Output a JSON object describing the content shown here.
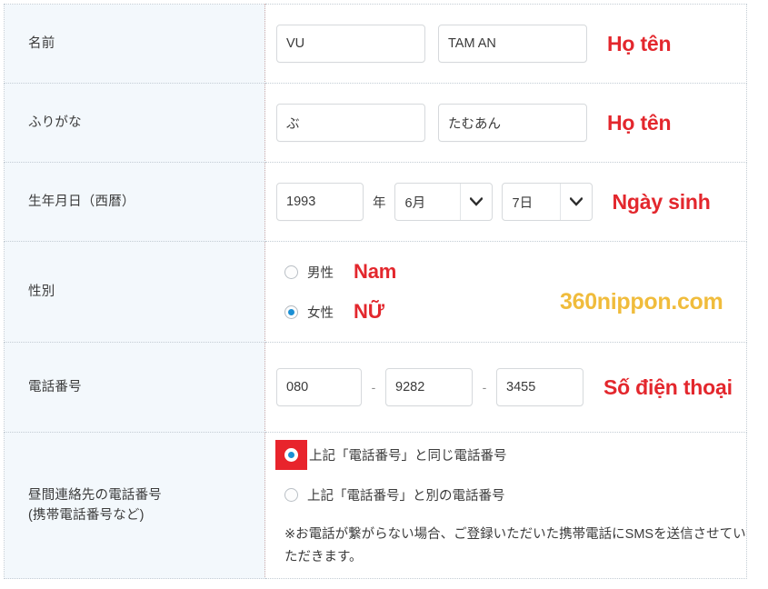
{
  "form": {
    "rows": [
      {
        "key": "name",
        "label": "名前",
        "annotation": "Họ tên",
        "fields": {
          "last_name": "VU",
          "first_name": "TAM AN"
        }
      },
      {
        "key": "kana",
        "label": "ふりがな",
        "annotation": "Họ tên",
        "fields": {
          "last_kana": "ぶ",
          "first_kana": "たむあん"
        }
      },
      {
        "key": "dob",
        "label": "生年月日（西暦）",
        "annotation": "Ngày sinh",
        "fields": {
          "year": "1993",
          "year_unit": "年",
          "month": "6月",
          "day": "7日"
        }
      },
      {
        "key": "gender",
        "label": "性別",
        "options": [
          {
            "label": "男性",
            "annotation": "Nam",
            "checked": false
          },
          {
            "label": "女性",
            "annotation": "NỮ",
            "checked": true
          }
        ]
      },
      {
        "key": "tel",
        "label": "電話番号",
        "annotation": "Số điện thoại",
        "fields": {
          "part1": "080",
          "part2": "9282",
          "part3": "3455",
          "separator": "-"
        }
      },
      {
        "key": "daytime_tel",
        "label_line1": "昼間連絡先の電話番号",
        "label_line2": "(携帯電話番号など)",
        "options": [
          {
            "label": "上記「電話番号」と同じ電話番号",
            "checked": true,
            "highlighted": true
          },
          {
            "label": "上記「電話番号」と別の電話番号",
            "checked": false,
            "highlighted": false
          }
        ],
        "note": "※お電話が繋がらない場合、ご登録いただいた携帯電話にSMSを送信させていただきます。"
      }
    ]
  },
  "watermark": {
    "text": "360nippon.com"
  },
  "colors": {
    "annotation_red": "#e3272d",
    "highlight_red": "#e8242c",
    "watermark_gold": "#f0bc3c",
    "radio_blue": "#1b8fd4",
    "label_bg": "#f3f8fc"
  }
}
